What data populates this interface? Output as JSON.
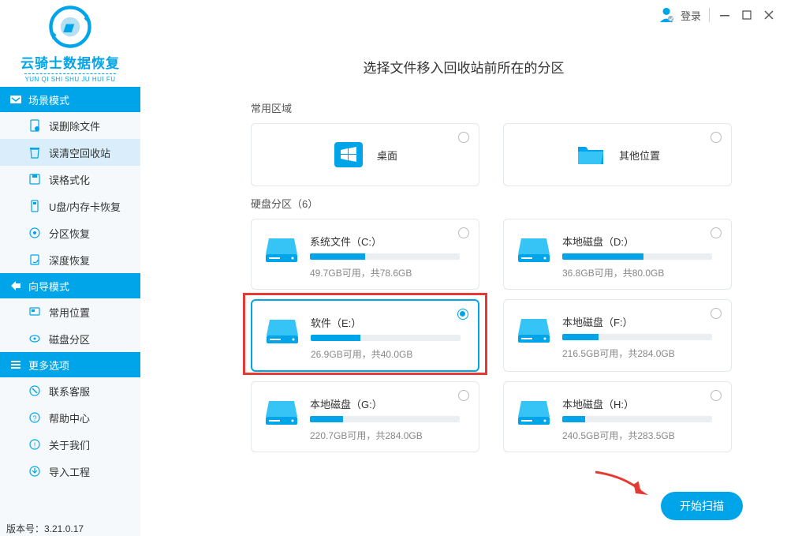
{
  "app_name": "云骑士数据恢复",
  "app_sub": "YUN QI SHI SHU JU HUI FU",
  "login_label": "登录",
  "title": "选择文件移入回收站前所在的分区",
  "section_common": "常用区域",
  "section_disk": "硬盘分区（6）",
  "version_label": "版本号：3.21.0.17",
  "scan_label": "开始扫描",
  "sidebar": {
    "sec1": "场景模式",
    "sec2": "向导模式",
    "sec3": "更多选项",
    "items": {
      "a0": "误删除文件",
      "a1": "误清空回收站",
      "a2": "误格式化",
      "a3": "U盘/内存卡恢复",
      "a4": "分区恢复",
      "a5": "深度恢复",
      "b0": "常用位置",
      "b1": "磁盘分区",
      "c0": "联系客服",
      "c1": "帮助中心",
      "c2": "关于我们",
      "c3": "导入工程"
    }
  },
  "common": {
    "desktop": "桌面",
    "other": "其他位置"
  },
  "drives": {
    "d0": {
      "name": "系统文件（C:）",
      "stat": "49.7GB可用，共78.6GB",
      "pct": 37
    },
    "d1": {
      "name": "本地磁盘（D:）",
      "stat": "36.8GB可用，共80.0GB",
      "pct": 54
    },
    "d2": {
      "name": "软件（E:）",
      "stat": "26.9GB可用，共40.0GB",
      "pct": 33
    },
    "d3": {
      "name": "本地磁盘（F:）",
      "stat": "216.5GB可用，共284.0GB",
      "pct": 24
    },
    "d4": {
      "name": "本地磁盘（G:）",
      "stat": "220.7GB可用，共284.0GB",
      "pct": 22
    },
    "d5": {
      "name": "本地磁盘（H:）",
      "stat": "240.5GB可用，共283.5GB",
      "pct": 15
    }
  }
}
